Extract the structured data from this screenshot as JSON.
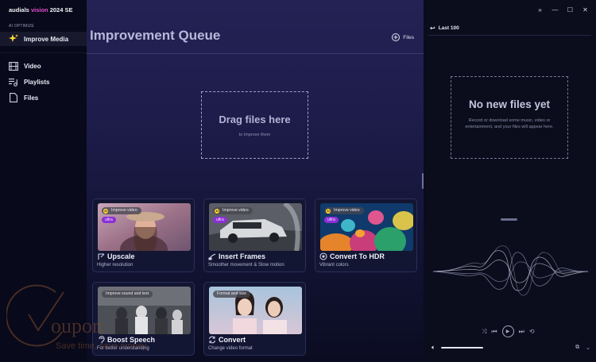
{
  "app": {
    "brand_prefix": "audials",
    "brand_accent": "vision",
    "brand_suffix": "2024 SE",
    "brand_accent_color": "#e14ed0"
  },
  "sidebar": {
    "section_label": "AI OPTIMIZE",
    "items": [
      {
        "label": "Improve Media",
        "icon": "sparkle-icon",
        "active": true
      },
      {
        "label": "Video",
        "icon": "film-icon",
        "active": false
      },
      {
        "label": "Playlists",
        "icon": "playlist-icon",
        "active": false
      },
      {
        "label": "Files",
        "icon": "file-icon",
        "active": false
      }
    ]
  },
  "main": {
    "title": "Improvement Queue",
    "files_button": "Files",
    "drop_zone": {
      "title": "Drag files here",
      "subtitle": "to improve them"
    },
    "cards": [
      {
        "title": "Upscale",
        "subtitle": "Higher resolution",
        "pill": "Improve video",
        "badge": "ultra",
        "icon": "upscale-icon"
      },
      {
        "title": "Insert Frames",
        "subtitle": "Smoother movement & Slow motion",
        "pill": "Improve video",
        "badge": "ultra",
        "icon": "frames-icon"
      },
      {
        "title": "Convert To HDR",
        "subtitle": "Vibrant colors",
        "pill": "Improve video",
        "badge": "ultra",
        "icon": "hdr-icon"
      },
      {
        "title": "Boost Speech",
        "subtitle": "For better understanding",
        "pill": "Improve sound and text",
        "badge": "",
        "icon": "ear-icon"
      },
      {
        "title": "Convert",
        "subtitle": "Change video format",
        "pill": "Format and size",
        "badge": "",
        "icon": "convert-icon"
      }
    ]
  },
  "right_panel": {
    "header": "Last 100",
    "empty_title": "No new files yet",
    "empty_body": "Record or download some music, video or entertainment, and your files will appear here."
  },
  "watermark": {
    "word": "oupon",
    "slogan": "Save time, save money"
  }
}
